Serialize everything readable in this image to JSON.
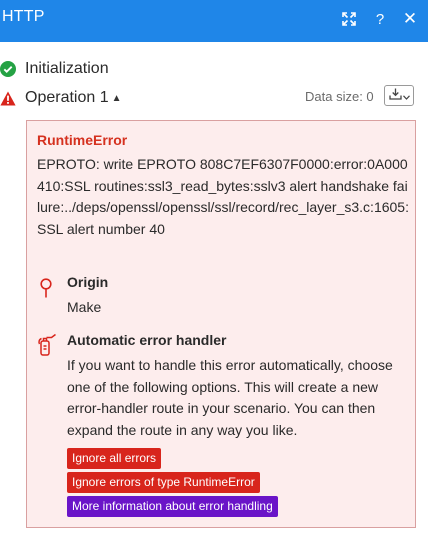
{
  "window": {
    "title": "HTTP",
    "help_label": "?",
    "close_label": "✕",
    "accent_color": "#1f86e8"
  },
  "steps": {
    "initialization": {
      "label": "Initialization",
      "status": "success",
      "icon": "check-circle-icon"
    },
    "operation": {
      "label": "Operation 1",
      "status": "error",
      "icon": "warning-triangle-icon",
      "caret": "▲"
    }
  },
  "data_size": {
    "label": "Data size: 0"
  },
  "error": {
    "title": "RuntimeError",
    "message": "EPROTO: write EPROTO 808C7EF6307F0000:error:0A000410:SSL routines:ssl3_read_bytes:sslv3 alert handshake failure:../deps/openssl/openssl/ssl/record/rec_layer_s3.c:1605:SSL alert number 40",
    "origin": {
      "title": "Origin",
      "value": "Make"
    },
    "handler": {
      "title": "Automatic error handler",
      "text": "If you want to handle this error automatically, choose one of the following options. This will create a new error-handler route in your scenario. You can then expand the route in any way you like."
    },
    "buttons": {
      "ignore_all": "Ignore all errors",
      "ignore_type": "Ignore errors of type RuntimeError",
      "more_info": "More information about error handling"
    },
    "colors": {
      "error_red": "#d8251c",
      "info_purple": "#6a14c8",
      "panel_bg": "#fdeded"
    }
  }
}
